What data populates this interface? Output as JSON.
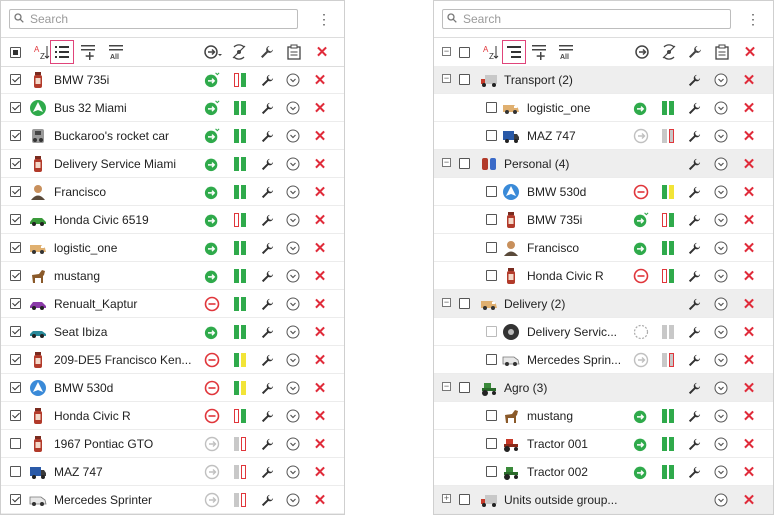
{
  "search": {
    "placeholder": "Search"
  },
  "left": {
    "units": [
      {
        "name": "BMW 735i",
        "checked": true,
        "move": "green-sub",
        "bars": [
          "#fff-r",
          "#2faa4b"
        ],
        "icon": "bottle-icon"
      },
      {
        "name": "Bus 32 Miami",
        "checked": true,
        "move": "green-sub",
        "bars": [
          "#2faa4b",
          "#2faa4b"
        ],
        "icon": "bus-circle-icon"
      },
      {
        "name": "Buckaroo's rocket car",
        "checked": true,
        "move": "green-sub",
        "bars": [
          "#2faa4b",
          "#2faa4b"
        ],
        "icon": "rocket-car-icon"
      },
      {
        "name": "Delivery Service Miami",
        "checked": true,
        "move": "green",
        "bars": [
          "#2faa4b",
          "#2faa4b"
        ],
        "icon": "bottle-icon"
      },
      {
        "name": "Francisco",
        "checked": true,
        "move": "green",
        "bars": [
          "#2faa4b",
          "#2faa4b"
        ],
        "icon": "person-icon"
      },
      {
        "name": "Honda Civic 6519",
        "checked": true,
        "move": "green",
        "bars": [
          "#fff-r",
          "#2faa4b"
        ],
        "icon": "car-green-icon"
      },
      {
        "name": "logistic_one",
        "checked": true,
        "move": "green",
        "bars": [
          "#2faa4b",
          "#2faa4b"
        ],
        "icon": "van-icon"
      },
      {
        "name": "mustang",
        "checked": true,
        "move": "green",
        "bars": [
          "#2faa4b",
          "#2faa4b"
        ],
        "icon": "horse-icon"
      },
      {
        "name": "Renualt_Kaptur",
        "checked": true,
        "move": "red",
        "bars": [
          "#2faa4b",
          "#2faa4b"
        ],
        "icon": "car-purple-icon"
      },
      {
        "name": "Seat Ibiza",
        "checked": true,
        "move": "green",
        "bars": [
          "#2faa4b",
          "#2faa4b"
        ],
        "icon": "car-teal-icon"
      },
      {
        "name": "209-DE5 Francisco Ken...",
        "checked": true,
        "move": "red",
        "bars": [
          "#2faa4b",
          "#f2e437"
        ],
        "icon": "bottle-icon"
      },
      {
        "name": "BMW 530d",
        "checked": true,
        "move": "red",
        "bars": [
          "#2faa4b",
          "#f2e437"
        ],
        "icon": "nav-circle-icon"
      },
      {
        "name": "Honda Civic R",
        "checked": true,
        "move": "red",
        "bars": [
          "#fff-r",
          "#2faa4b"
        ],
        "icon": "bottle-icon"
      },
      {
        "name": "1967 Pontiac GTO",
        "checked": false,
        "move": "gray",
        "bars": [
          "#c8c8c8",
          "#fff-r"
        ],
        "icon": "bottle-icon"
      },
      {
        "name": "MAZ 747",
        "checked": false,
        "move": "gray",
        "bars": [
          "#c8c8c8",
          "#fff-r"
        ],
        "icon": "truck-blue-icon"
      },
      {
        "name": "Mercedes Sprinter",
        "checked": true,
        "move": "gray",
        "bars": [
          "#c8c8c8",
          "#fff-r"
        ],
        "icon": "van-white-icon"
      }
    ]
  },
  "right": {
    "rows": [
      {
        "type": "group",
        "name": "Transport (2)",
        "icon": "truck-red-icon",
        "expanded": true
      },
      {
        "type": "unit",
        "name": "logistic_one",
        "move": "green",
        "bars": [
          "#2faa4b",
          "#2faa4b"
        ],
        "icon": "van-icon"
      },
      {
        "type": "unit",
        "name": "MAZ 747",
        "move": "gray",
        "bars": [
          "#c8c8c8",
          "#c8c8c8-r"
        ],
        "icon": "truck-blue-icon"
      },
      {
        "type": "group",
        "name": "Personal (4)",
        "icon": "people-icon",
        "expanded": true
      },
      {
        "type": "unit",
        "name": "BMW 530d",
        "move": "red",
        "bars": [
          "#2faa4b",
          "#f2e437"
        ],
        "icon": "nav-circle-icon"
      },
      {
        "type": "unit",
        "name": "BMW 735i",
        "move": "green-sub",
        "bars": [
          "#fff-r",
          "#2faa4b"
        ],
        "icon": "bottle-icon"
      },
      {
        "type": "unit",
        "name": "Francisco",
        "move": "green",
        "bars": [
          "#2faa4b",
          "#2faa4b"
        ],
        "icon": "person-icon"
      },
      {
        "type": "unit",
        "name": "Honda Civic R",
        "move": "red",
        "bars": [
          "#fff-r",
          "#2faa4b"
        ],
        "icon": "bottle-icon"
      },
      {
        "type": "group",
        "name": "Delivery (2)",
        "icon": "van-icon",
        "expanded": true
      },
      {
        "type": "unit",
        "name": "Delivery Servic...",
        "move": "dashed",
        "bars": [
          "#c8c8c8",
          "#c8c8c8"
        ],
        "icon": "wheel-icon",
        "disabled": true
      },
      {
        "type": "unit",
        "name": "Mercedes Sprin...",
        "move": "gray",
        "bars": [
          "#c8c8c8",
          "#c8c8c8-r"
        ],
        "icon": "van-white-icon"
      },
      {
        "type": "group",
        "name": "Agro (3)",
        "icon": "tractor-icon",
        "expanded": true
      },
      {
        "type": "unit",
        "name": "mustang",
        "move": "green",
        "bars": [
          "#2faa4b",
          "#2faa4b"
        ],
        "icon": "horse-icon"
      },
      {
        "type": "unit",
        "name": "Tractor 001",
        "move": "green",
        "bars": [
          "#2faa4b",
          "#2faa4b"
        ],
        "icon": "tractor-red-icon"
      },
      {
        "type": "unit",
        "name": "Tractor 002",
        "move": "green",
        "bars": [
          "#2faa4b",
          "#2faa4b"
        ],
        "icon": "tractor-icon"
      },
      {
        "type": "group",
        "name": "Units outside group...",
        "icon": "truck-red-icon",
        "expanded": false
      }
    ]
  },
  "toolbar": {
    "sort_az": "A-Z",
    "all_label": "All"
  },
  "colors": {
    "accent_active": "#e0447a",
    "move_green": "#2faa4b",
    "move_red": "#e0363b",
    "delete": "#e02b3a",
    "group_bg": "#eeeeee"
  }
}
